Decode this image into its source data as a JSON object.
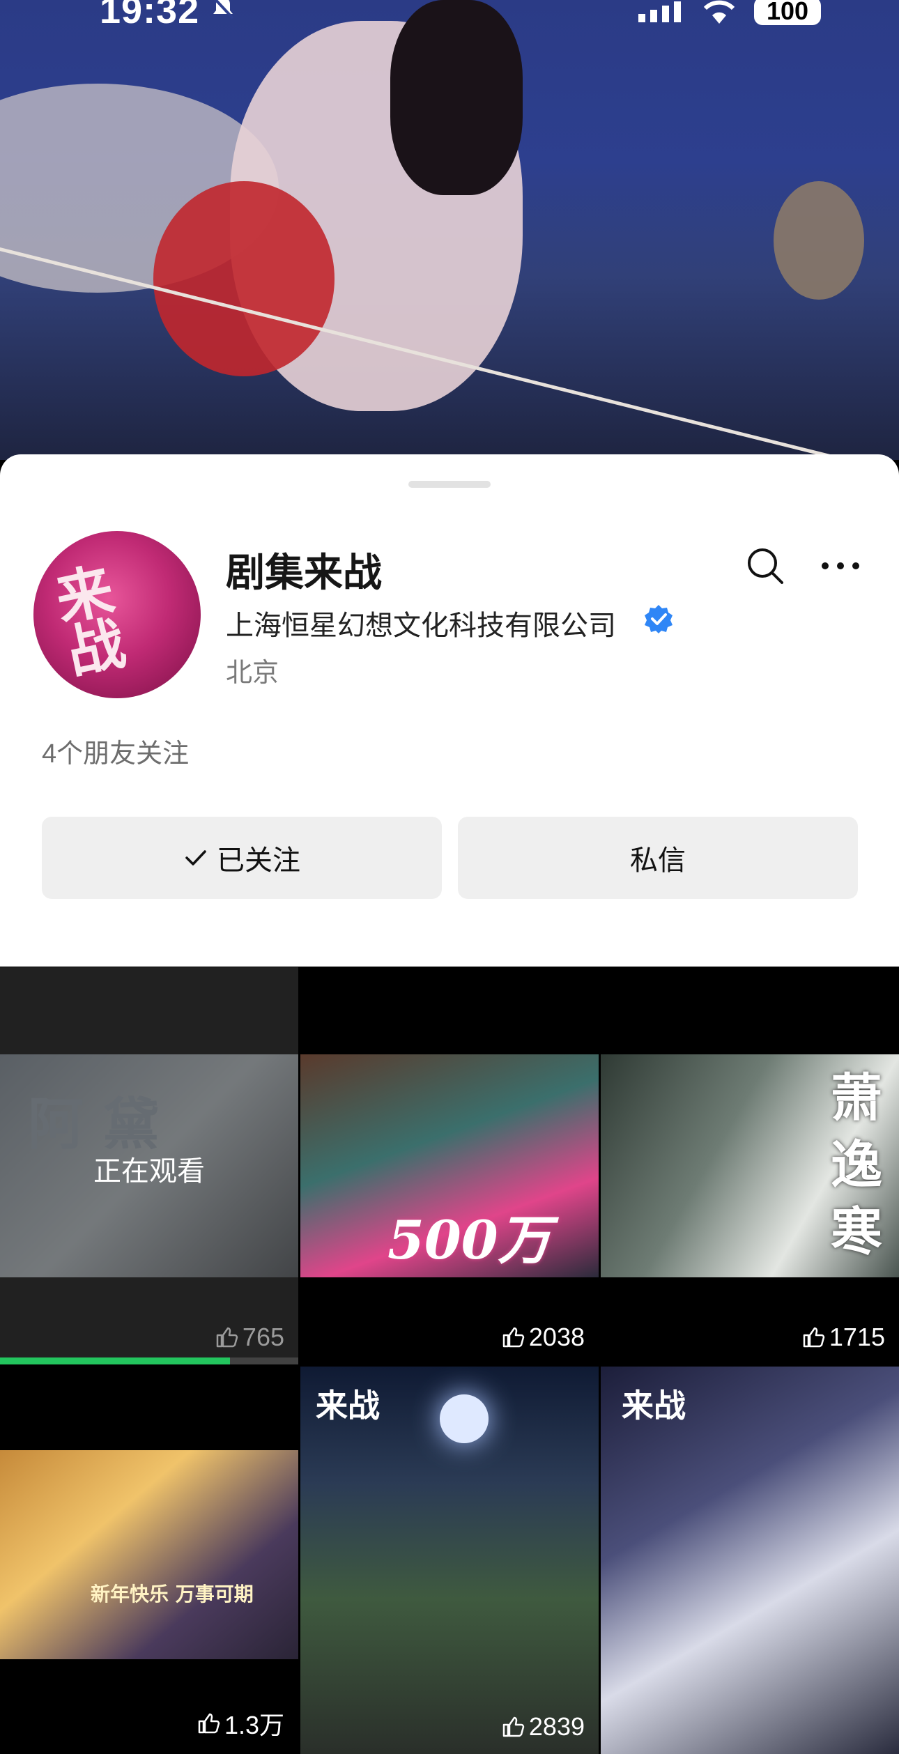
{
  "status_bar": {
    "time": "19:32",
    "battery": "100"
  },
  "profile": {
    "name": "剧集来战",
    "company": "上海恒星幻想文化科技有限公司",
    "location": "北京",
    "friends_following": "4个朋友关注",
    "avatar_text": "来战"
  },
  "actions": {
    "follow_label": "已关注",
    "message_label": "私信"
  },
  "grid": {
    "watching_label": "正在观看",
    "watching_progress": 0.77,
    "tiles": [
      {
        "likes": "765",
        "overlay": "阿 黛"
      },
      {
        "likes": "2038",
        "overlay": "500万"
      },
      {
        "likes": "1715",
        "overlay": "萧逸寒"
      },
      {
        "likes": "1.3万",
        "overlay": "新年快乐 万事可期"
      },
      {
        "likes": "2839",
        "overlay": "来战"
      },
      {
        "likes": "",
        "overlay": "来战"
      }
    ]
  },
  "colors": {
    "verified": "#2f86f6",
    "progress": "#23c55e",
    "button_bg": "#efefef"
  }
}
